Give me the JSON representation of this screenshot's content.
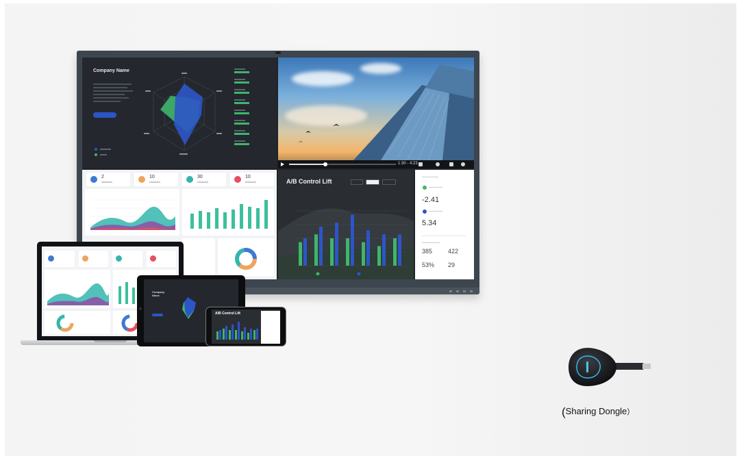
{
  "dashboard": {
    "company_name": "Company Name",
    "radar_colors": {
      "blue": "#2d55c8",
      "green": "#3fb56d"
    }
  },
  "video_player": {
    "time": "1:30 - 4:23",
    "progress_fraction": 0.34
  },
  "kpis": [
    {
      "value": "2",
      "color": "#3f79d6"
    },
    {
      "value": "10",
      "color": "#f0a35e"
    },
    {
      "value": "30",
      "color": "#34b6ad"
    },
    {
      "value": "10",
      "color": "#e4505f"
    }
  ],
  "ab_panel": {
    "title": "A/B Control Lift",
    "bars": [
      {
        "green": 6,
        "blue": 7
      },
      {
        "green": 8,
        "blue": 10
      },
      {
        "green": 7,
        "blue": 11
      },
      {
        "green": 7,
        "blue": 13
      },
      {
        "green": 6,
        "blue": 9
      },
      {
        "green": 5,
        "blue": 8
      },
      {
        "green": 7,
        "blue": 8
      }
    ],
    "series_colors": {
      "green": "#3fb56d",
      "blue": "#2d55c8"
    }
  },
  "side_panel": {
    "value_1": "-2.41",
    "value_2": "5.34",
    "stat_a": "385",
    "stat_b": "422",
    "stat_c": "53%",
    "stat_d": "29"
  },
  "phone": {
    "title": "A/B Control Lift"
  },
  "tablet": {
    "company_name": "Company Name"
  },
  "product": {
    "caption_open": "(",
    "caption_text": "Sharing Dongle",
    "caption_close": "）"
  }
}
